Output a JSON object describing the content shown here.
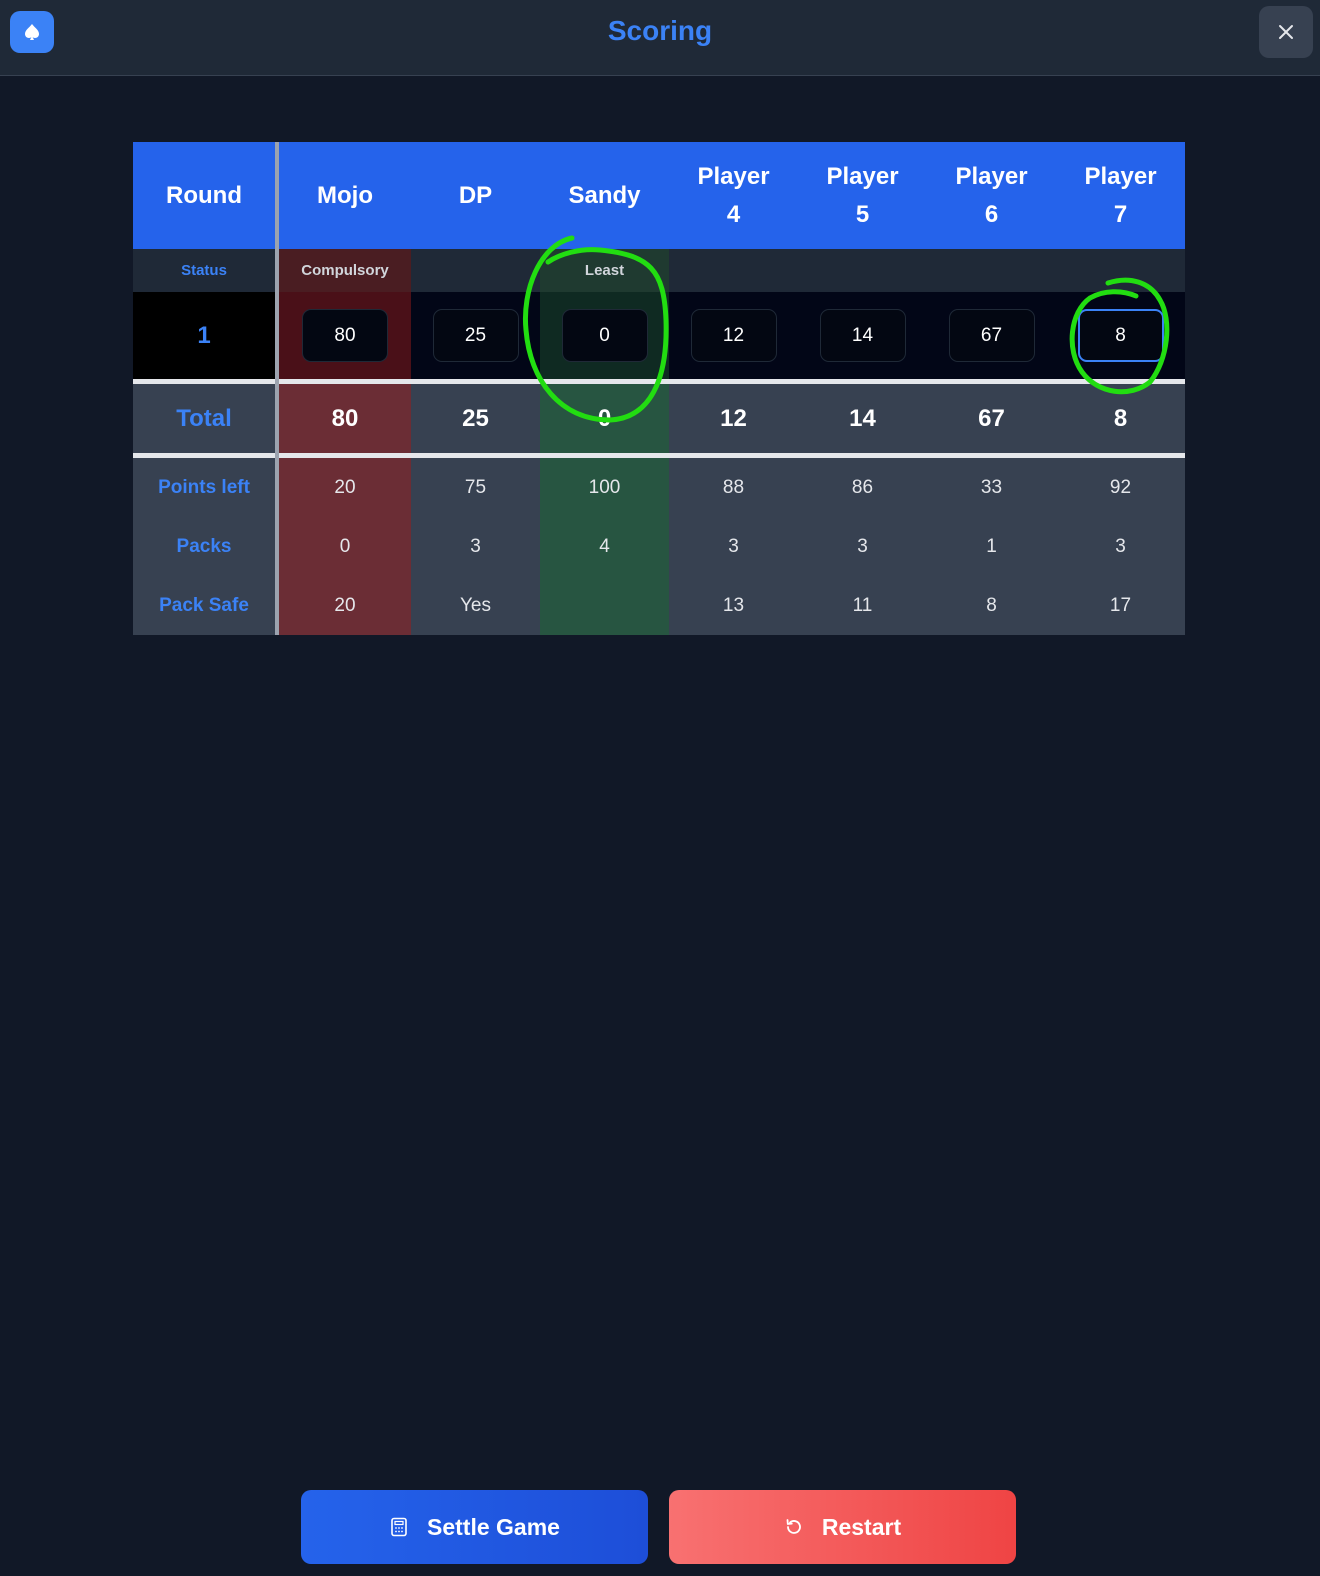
{
  "app": {
    "title": "Scoring",
    "icon": "spade-icon",
    "close_icon": "close-icon"
  },
  "table": {
    "header_round": "Round",
    "players": [
      "Mojo",
      "DP",
      "Sandy",
      "Player 4",
      "Player 5",
      "Player 6",
      "Player 7"
    ],
    "status_label": "Status",
    "statuses": [
      "Compulsory",
      "",
      "Least",
      "",
      "",
      "",
      ""
    ],
    "rounds": [
      {
        "number": "1",
        "scores": [
          "80",
          "25",
          "0",
          "12",
          "14",
          "67",
          "8"
        ]
      }
    ],
    "total_label": "Total",
    "totals": [
      "80",
      "25",
      "0",
      "12",
      "14",
      "67",
      "8"
    ],
    "stats": [
      {
        "label": "Points left",
        "values": [
          "20",
          "75",
          "100",
          "88",
          "86",
          "33",
          "92"
        ]
      },
      {
        "label": "Packs",
        "values": [
          "0",
          "3",
          "4",
          "3",
          "3",
          "1",
          "3"
        ]
      },
      {
        "label": "Pack Safe",
        "values": [
          "20",
          "Yes",
          "",
          "13",
          "11",
          "8",
          "17"
        ]
      }
    ],
    "highlight_colors": {
      "compulsory": "#6b2d35",
      "least": "#275541",
      "header": "#2563eb"
    }
  },
  "buttons": {
    "settle_label": "Settle Game",
    "settle_icon": "calculator-icon",
    "restart_label": "Restart",
    "restart_icon": "restart-icon"
  },
  "annotations": {
    "color": "#22dd11"
  }
}
